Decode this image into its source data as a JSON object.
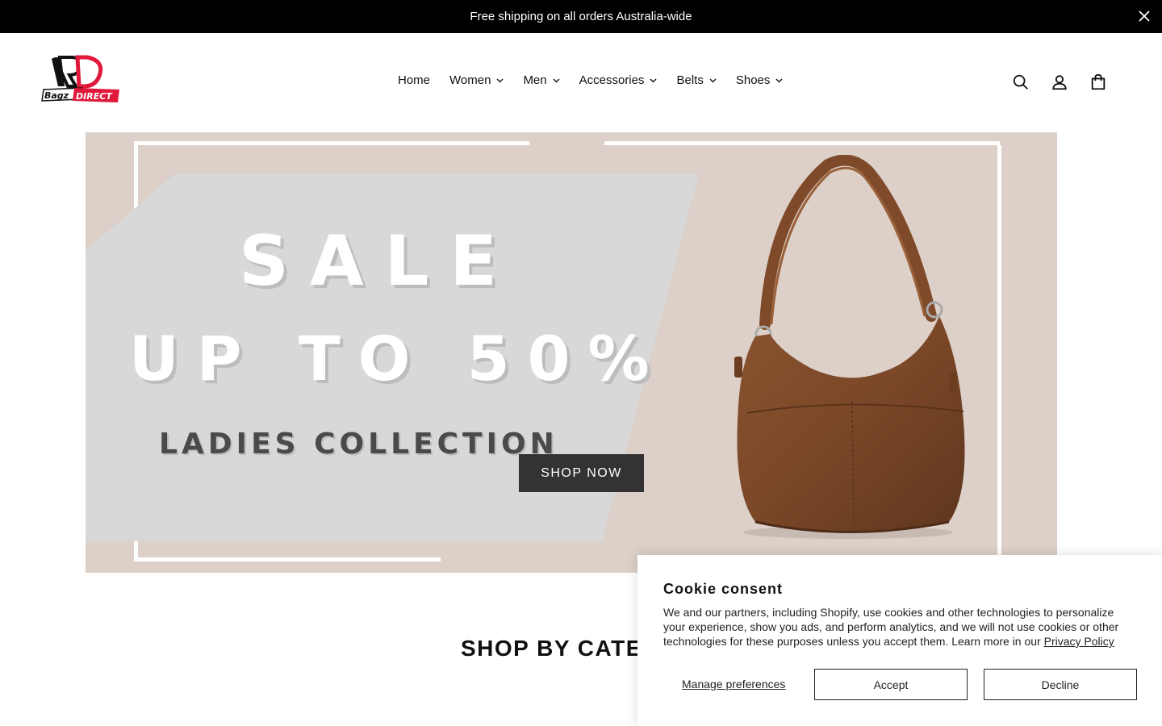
{
  "announcement": {
    "text": "Free shipping on all orders Australia-wide",
    "close_icon": "close-icon"
  },
  "header": {
    "logo_text": "BagzDIRECT",
    "nav": [
      {
        "label": "Home",
        "has_dropdown": false
      },
      {
        "label": "Women",
        "has_dropdown": true
      },
      {
        "label": "Men",
        "has_dropdown": true
      },
      {
        "label": "Accessories",
        "has_dropdown": true
      },
      {
        "label": "Belts",
        "has_dropdown": true
      },
      {
        "label": "Shoes",
        "has_dropdown": true
      }
    ],
    "icons": [
      "search-icon",
      "account-icon",
      "cart-icon"
    ]
  },
  "hero": {
    "headline": "SALE",
    "subheadline": "UP TO 50%",
    "collection": "LADIES COLLECTION",
    "cta_label": "SHOP NOW",
    "background_color": "#dcd0c8"
  },
  "section": {
    "title": "SHOP BY CATEGORY"
  },
  "cookie": {
    "title": "Cookie consent",
    "body": "We and our partners, including Shopify, use cookies and other technologies to personalize your experience, show you ads, and perform analytics, and we will not use cookies or other technologies for these purposes unless you accept them. Learn more in our ",
    "privacy_link": "Privacy Policy",
    "manage_label": "Manage preferences",
    "accept_label": "Accept",
    "decline_label": "Decline"
  }
}
